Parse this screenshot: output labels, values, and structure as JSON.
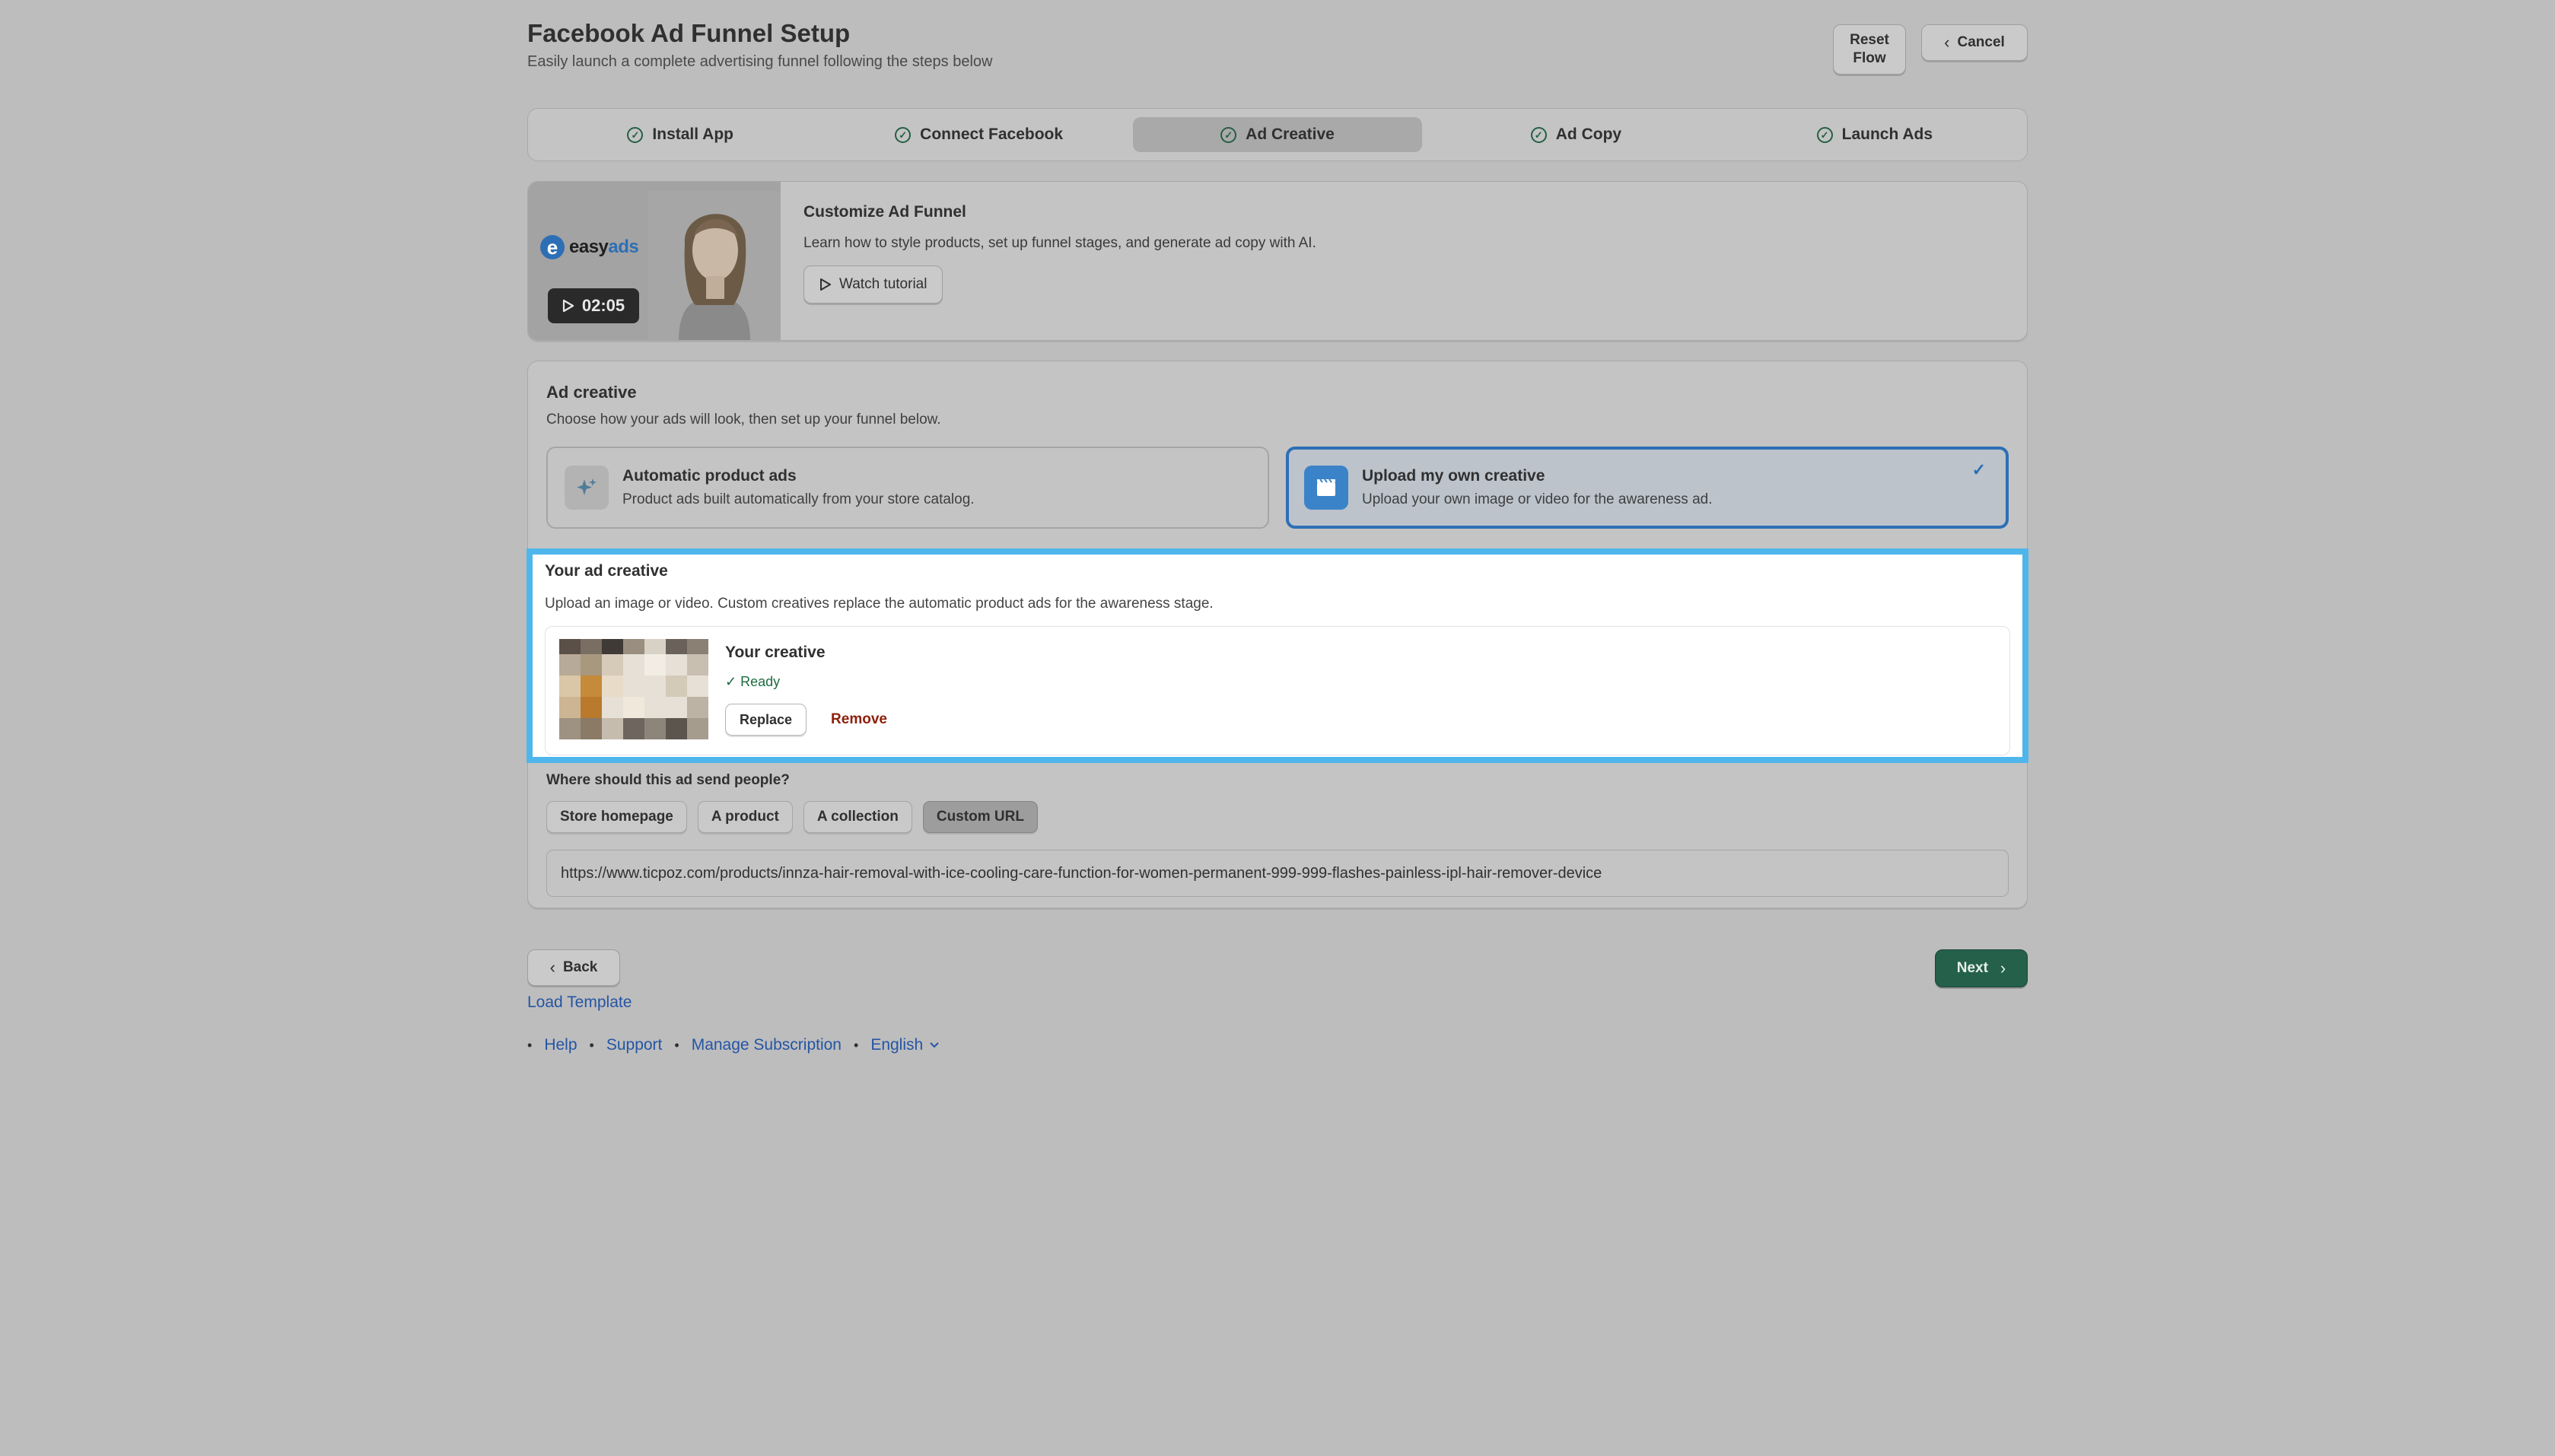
{
  "header": {
    "title": "Facebook Ad Funnel Setup",
    "subtitle": "Easily launch a complete advertising funnel following the steps below",
    "reset_label_line1": "Reset",
    "reset_label_line2": "Flow",
    "cancel_label": "Cancel"
  },
  "steps": [
    {
      "label": "Install App",
      "completed": true
    },
    {
      "label": "Connect Facebook",
      "completed": true
    },
    {
      "label": "Ad Creative",
      "completed": true,
      "active": true
    },
    {
      "label": "Ad Copy",
      "completed": true
    },
    {
      "label": "Launch Ads",
      "completed": true
    }
  ],
  "tutorial": {
    "logo_text_a": "easy",
    "logo_text_b": "ads",
    "duration": "02:05",
    "title": "Customize Ad Funnel",
    "description": "Learn how to style products, set up funnel stages, and generate ad copy with AI.",
    "button_label": "Watch tutorial"
  },
  "ad_creative": {
    "title": "Ad creative",
    "description": "Choose how your ads will look, then set up your funnel below.",
    "options": [
      {
        "title": "Automatic product ads",
        "description": "Product ads built automatically from your store catalog.",
        "icon": "sparkle-icon",
        "selected": false
      },
      {
        "title": "Upload my own creative",
        "description": "Upload your own image or video for the awareness ad.",
        "icon": "film-icon",
        "selected": true
      }
    ]
  },
  "your_creative": {
    "title": "Your ad creative",
    "description": "Upload an image or video. Custom creatives replace the automatic product ads for the awareness stage.",
    "item_title": "Your creative",
    "status": "Ready",
    "replace_label": "Replace",
    "remove_label": "Remove"
  },
  "destination": {
    "label": "Where should this ad send people?",
    "options": [
      {
        "label": "Store homepage",
        "selected": false
      },
      {
        "label": "A product",
        "selected": false
      },
      {
        "label": "A collection",
        "selected": false
      },
      {
        "label": "Custom URL",
        "selected": true
      }
    ],
    "url_value": "https://www.ticpoz.com/products/innza-hair-removal-with-ice-cooling-care-function-for-women-permanent-999-999-flashes-painless-ipl-hair-remover-device"
  },
  "nav": {
    "back_label": "Back",
    "next_label": "Next",
    "load_template": "Load Template"
  },
  "footer": {
    "links": [
      "Help",
      "Support",
      "Manage Subscription"
    ],
    "language": "English"
  },
  "colors": {
    "accent_blue": "#2d6fb5",
    "highlight_border": "#4fb6ec",
    "primary_green": "#24604a",
    "danger": "#8e1f0b",
    "success": "#1e6b40"
  }
}
